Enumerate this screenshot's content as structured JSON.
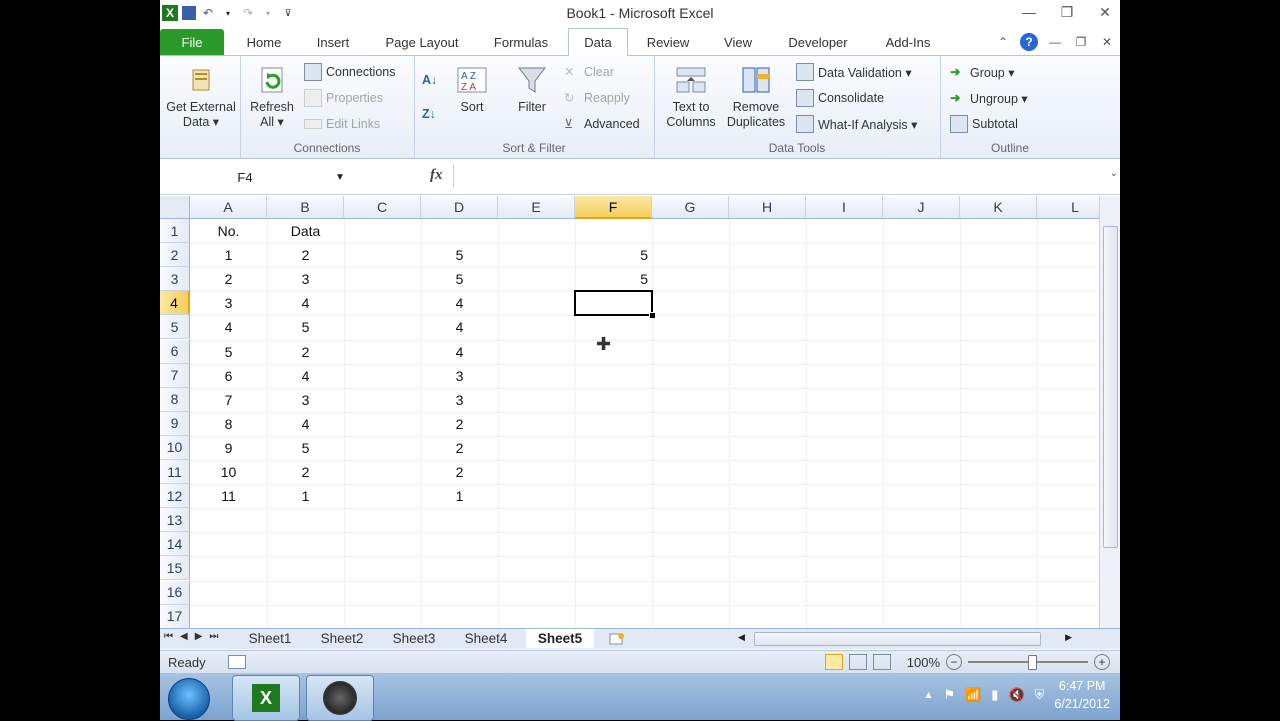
{
  "window": {
    "title": "Book1 - Microsoft Excel"
  },
  "tabs": [
    {
      "label": "File"
    },
    {
      "label": "Home"
    },
    {
      "label": "Insert"
    },
    {
      "label": "Page Layout"
    },
    {
      "label": "Formulas"
    },
    {
      "label": "Data"
    },
    {
      "label": "Review"
    },
    {
      "label": "View"
    },
    {
      "label": "Developer"
    },
    {
      "label": "Add-Ins"
    }
  ],
  "ribbon": {
    "get_external": {
      "line1": "Get External",
      "line2": "Data ▾"
    },
    "refresh": {
      "line1": "Refresh",
      "line2": "All ▾"
    },
    "connections": "Connections",
    "properties": "Properties",
    "edit_links": "Edit Links",
    "connections_group": "Connections",
    "sort": "Sort",
    "filter": "Filter",
    "clear": "Clear",
    "reapply": "Reapply",
    "advanced": "Advanced",
    "sort_filter_group": "Sort & Filter",
    "text_to_columns": {
      "line1": "Text to",
      "line2": "Columns"
    },
    "remove_duplicates": {
      "line1": "Remove",
      "line2": "Duplicates"
    },
    "data_validation": "Data Validation ▾",
    "consolidate": "Consolidate",
    "what_if": "What-If Analysis ▾",
    "data_tools_group": "Data Tools",
    "group": "Group ▾",
    "ungroup": "Ungroup ▾",
    "subtotal": "Subtotal",
    "outline_group": "Outline"
  },
  "formula_bar": {
    "name_box": "F4",
    "fx": "fx",
    "content": ""
  },
  "columns": [
    "A",
    "B",
    "C",
    "D",
    "E",
    "F",
    "G",
    "H",
    "I",
    "J",
    "K",
    "L"
  ],
  "rows": [
    "1",
    "2",
    "3",
    "4",
    "5",
    "6",
    "7",
    "8",
    "9",
    "10",
    "11",
    "12",
    "13",
    "14",
    "15",
    "16",
    "17"
  ],
  "cells": {
    "A": [
      "No.",
      "1",
      "2",
      "3",
      "4",
      "5",
      "6",
      "7",
      "8",
      "9",
      "10",
      "11"
    ],
    "B": [
      "Data",
      "2",
      "3",
      "4",
      "5",
      "2",
      "4",
      "3",
      "4",
      "5",
      "2",
      "1"
    ],
    "D": [
      "",
      "5",
      "5",
      "4",
      "4",
      "4",
      "3",
      "3",
      "2",
      "2",
      "2",
      "1"
    ],
    "F": [
      "",
      "5",
      "5"
    ]
  },
  "sheets": [
    "Sheet1",
    "Sheet2",
    "Sheet3",
    "Sheet4",
    "Sheet5"
  ],
  "active_sheet": "Sheet5",
  "status": {
    "ready": "Ready",
    "zoom": "100%"
  },
  "taskbar": {
    "time": "6:47 PM",
    "date": "6/21/2012"
  },
  "colors": {
    "file_tab": "#2a9b2a",
    "selection_header": "#f6cd5b",
    "ribbon_bg": "#e7eef8"
  }
}
